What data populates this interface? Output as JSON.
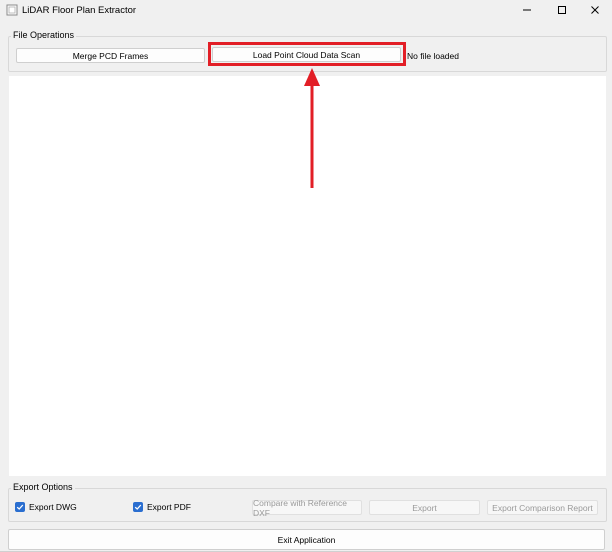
{
  "window": {
    "title": "LiDAR Floor Plan Extractor"
  },
  "file_operations": {
    "group_title": "File Operations",
    "merge_button": "Merge PCD Frames",
    "load_button": "Load Point Cloud Data Scan",
    "status": "No file loaded"
  },
  "export_options": {
    "group_title": "Export Options",
    "export_dwg": {
      "label": "Export DWG",
      "checked": true
    },
    "export_pdf": {
      "label": "Export PDF",
      "checked": true
    },
    "compare_button": "Compare with Reference DXF",
    "export_button": "Export",
    "export_report_button": "Export Comparison Report"
  },
  "footer": {
    "exit_button": "Exit Application"
  },
  "colors": {
    "highlight": "#e21e26",
    "checkbox": "#2a6ed0"
  }
}
